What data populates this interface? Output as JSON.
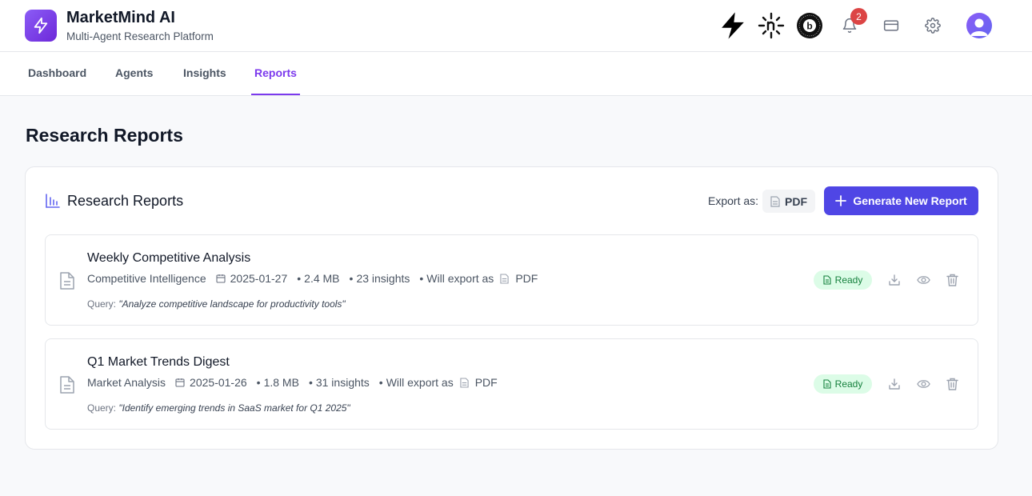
{
  "app": {
    "title": "MarketMind AI",
    "subtitle": "Multi-Agent Research Platform",
    "notification_count": "2",
    "icons": [
      "bolt-icon",
      "n8n-icon",
      "b-logo-icon",
      "bell-icon",
      "card-icon",
      "gear-icon",
      "avatar"
    ]
  },
  "tabs": [
    {
      "label": "Dashboard",
      "active": false
    },
    {
      "label": "Agents",
      "active": false
    },
    {
      "label": "Insights",
      "active": false
    },
    {
      "label": "Reports",
      "active": true
    }
  ],
  "page": {
    "title": "Research Reports"
  },
  "panel": {
    "title": "Research Reports",
    "export_label": "Export as:",
    "export_format": "PDF",
    "generate_label": "Generate New Report"
  },
  "reports": [
    {
      "title": "Weekly Competitive Analysis",
      "category": "Competitive Intelligence",
      "date": "2025-01-27",
      "size": "2.4 MB",
      "insights": "23 insights",
      "export_prefix": "Will export as",
      "export_format": "PDF",
      "query_label": "Query:",
      "query": "\"Analyze competitive landscape for productivity tools\"",
      "status": "Ready"
    },
    {
      "title": "Q1 Market Trends Digest",
      "category": "Market Analysis",
      "date": "2025-01-26",
      "size": "1.8 MB",
      "insights": "31 insights",
      "export_prefix": "Will export as",
      "export_format": "PDF",
      "query_label": "Query:",
      "query": "\"Identify emerging trends in SaaS market for Q1 2025\"",
      "status": "Ready"
    }
  ],
  "colors": {
    "accent": "#7c3aed",
    "primary_button": "#4f46e5",
    "status_ready_bg": "#dcfce7",
    "status_ready_text": "#15803d",
    "badge": "#dc4545"
  }
}
